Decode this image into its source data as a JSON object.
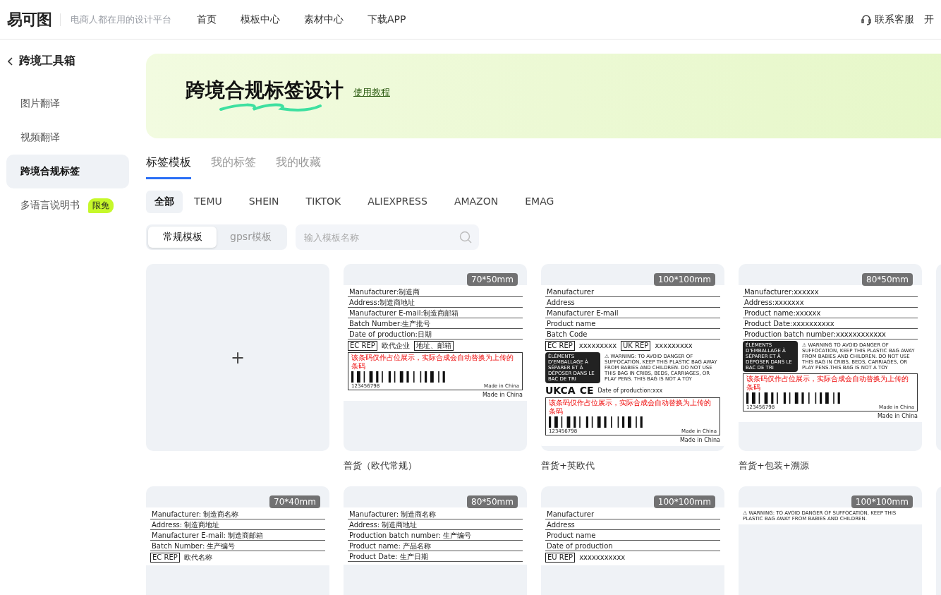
{
  "header": {
    "logo": "易可图",
    "slogan": "电商人都在用的设计平台",
    "nav": [
      "首页",
      "模板中心",
      "素材中心",
      "下载APP"
    ],
    "support": "联系客服",
    "cut_link": "开"
  },
  "sidebar": {
    "title": "跨境工具箱",
    "items": [
      {
        "label": "图片翻译",
        "selected": false
      },
      {
        "label": "视频翻译",
        "selected": false
      },
      {
        "label": "跨境合规标签",
        "selected": true
      },
      {
        "label": "多语言说明书",
        "selected": false,
        "badge": "限免"
      }
    ]
  },
  "banner": {
    "title": "跨境合规标签设计",
    "link": "使用教程"
  },
  "tabs": [
    {
      "label": "标签模板",
      "selected": true
    },
    {
      "label": "我的标签",
      "selected": false
    },
    {
      "label": "我的收藏",
      "selected": false
    }
  ],
  "platforms": [
    {
      "label": "全部",
      "selected": true
    },
    {
      "label": "TEMU",
      "selected": false
    },
    {
      "label": "SHEIN",
      "selected": false
    },
    {
      "label": "TIKTOK",
      "selected": false
    },
    {
      "label": "ALIEXPRESS",
      "selected": false
    },
    {
      "label": "AMAZON",
      "selected": false
    },
    {
      "label": "EMAG",
      "selected": false
    }
  ],
  "template_types": [
    {
      "label": "常规模板",
      "selected": true
    },
    {
      "label": "gpsr模板",
      "selected": false
    }
  ],
  "search": {
    "placeholder": "输入模板名称"
  },
  "cards": [
    {
      "kind": "new",
      "symbol": "+"
    },
    {
      "kind": "template",
      "size": "70*50mm",
      "title": "普货（欧代常规）",
      "label": {
        "lines": [
          "Manufacturer:制造商",
          "Address:制造商地址",
          "Manufacturer E-mail:制造商邮箱",
          "Batch Number:生产批号",
          "Date of production:日期"
        ],
        "rep": [
          "EC REP",
          "欧代企业",
          "地址、邮箱"
        ],
        "barcode": {
          "note": "该条码仅作占位展示，实际合成会自动替换为上传的条码",
          "number": "123456798",
          "origin": "Made in China"
        },
        "footer": "Made in China"
      }
    },
    {
      "kind": "template",
      "size": "100*100mm",
      "title": "普货+英欧代",
      "label": {
        "lines": [
          "Manufacturer",
          "Address",
          "Manufacturer E-mail",
          "Product name",
          "Batch Code"
        ],
        "rep": [
          "EC REP",
          "xxxxxxxxx",
          "UK REP",
          "xxxxxxxxx"
        ],
        "triman": "ÉLÉMENTS D'EMBALLAGE À SÉPARER ET À DÉPOSER DANS LE BAC DE TRI",
        "warning": "⚠ WARNING: TO AVOID DANGER OF SUFFOCATION, KEEP THIS PLASTIC BAG AWAY FROM BABIES AND CHILDREN. DO NOT USE THIS BAG IN CRIBS, BEDS, CARRIAGES, OR PLAY PENS. THIS BAG IS NOT A TOY",
        "marks": [
          "UKCA",
          "CE"
        ],
        "date": "Date of production:xxx",
        "barcode": {
          "note": "该条码仅作占位展示，实际合成会自动替换为上传的条码",
          "number": "123456798",
          "origin": "Made in China"
        },
        "footer": "Made in China"
      }
    },
    {
      "kind": "template",
      "size": "80*50mm",
      "title": "普货+包装+溯源",
      "label": {
        "lines": [
          "Manufacturer:xxxxxx",
          "Address:xxxxxxx",
          "Product name:xxxxxx",
          "Product Date:xxxxxxxxxx",
          "Production batch number:xxxxxxxxxxxx"
        ],
        "triman": "ÉLÉMENTS D'EMBALLAGE À SÉPARER ET À DÉPOSER DANS LE BAC DE TRI",
        "warning": "⚠ WARNING TO AVOID DANGER OF SUFFOCATION, KEEP THIS PLASTIC BAG AWAY FROM BABIES AND CHILDREN. DO NOT USE THIS BAG IN CRIBS, BEDS, CARRIAGES, OR PLAY PENS.THIS BAG IS NOT A TOY",
        "barcode": {
          "note": "该条码仅作占位展示，实际合成会自动替换为上传的条码",
          "number": "123456798",
          "origin": "Made in China"
        },
        "footer": "Made in China"
      }
    },
    {
      "kind": "template"
    },
    {
      "kind": "template",
      "size": "70*40mm",
      "label": {
        "lines": [
          "Manufacturer: 制造商名称",
          "Address: 制造商地址",
          "Manufacturer E-mail: 制造商邮箱",
          "Batch Number: 生产编号"
        ],
        "rep": [
          "EC REP",
          "欧代名称"
        ]
      }
    },
    {
      "kind": "template",
      "size": "80*50mm",
      "label": {
        "lines": [
          "Manufacturer: 制造商名称",
          "Address: 制造商地址",
          "Production batch number: 生产编号",
          "Product name: 产品名称",
          "Product Date: 生产日期"
        ]
      }
    },
    {
      "kind": "template",
      "size": "100*100mm",
      "label": {
        "lines": [
          "Manufacturer",
          "Address",
          "Product name",
          "Date of production"
        ],
        "rep": [
          "EU REP",
          "xxxxxxxxxxx"
        ]
      }
    },
    {
      "kind": "template",
      "size": "100*100mm",
      "label": {
        "warning": "⚠ WARNING: TO AVOID DANGER OF SUFFOCATION, KEEP THIS PLASTIC BAG AWAY FROM BABIES AND CHILDREN."
      }
    },
    {
      "kind": "template"
    }
  ]
}
